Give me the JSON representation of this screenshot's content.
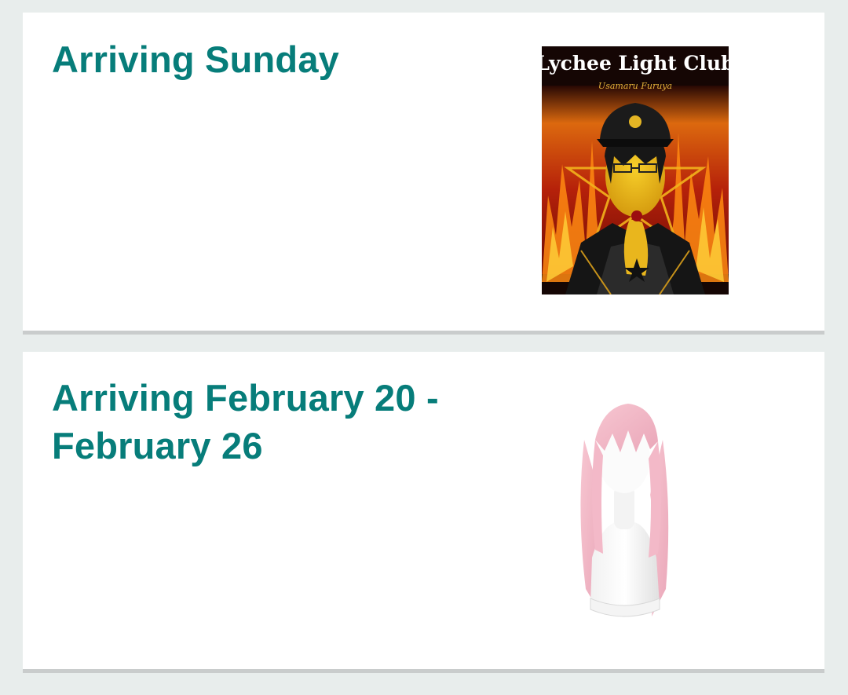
{
  "orders": [
    {
      "arrival_text": "Arriving Sunday",
      "product": {
        "kind": "book-cover",
        "cover_title": "Lychee Light Club",
        "cover_author": "Usamaru Furuya"
      }
    },
    {
      "arrival_text": "Arriving February 20 - February 26",
      "product": {
        "kind": "pink-wig-on-mannequin"
      }
    }
  ],
  "colors": {
    "accent": "#077d7a",
    "background": "#e8edec",
    "card": "#ffffff",
    "divider": "#c9cccc"
  }
}
